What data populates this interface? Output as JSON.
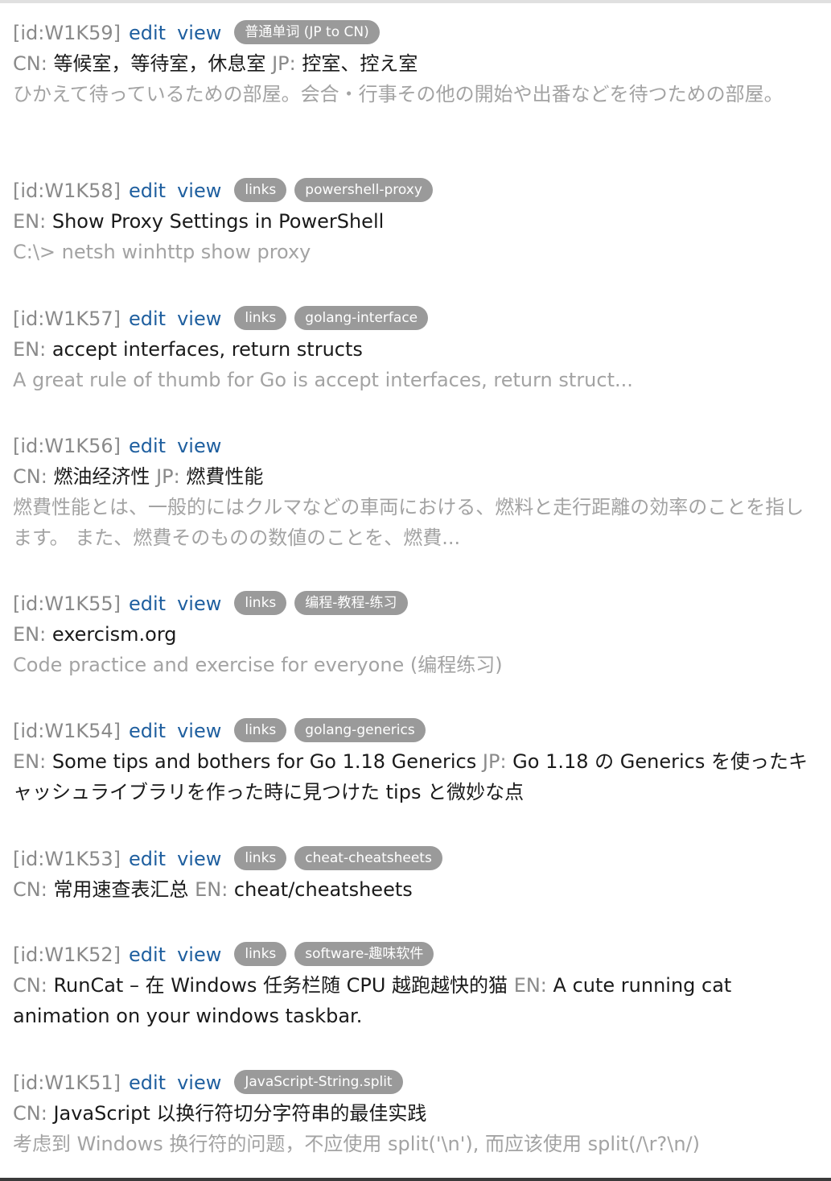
{
  "action_labels": {
    "edit": "edit",
    "view": "view"
  },
  "entries": [
    {
      "id": "[id:W1K59]",
      "tags": [
        "普通单词 (JP to CN)"
      ],
      "line": [
        {
          "label": "CN:",
          "text": "等候室，等待室，休息室"
        },
        {
          "label": "JP:",
          "text": "控室、控え室"
        }
      ],
      "desc": "ひかえて待っているための部屋。会合・行事その他の開始や出番などを待つための部屋。"
    },
    {
      "id": "[id:W1K58]",
      "tags": [
        "links",
        "powershell-proxy"
      ],
      "line": [
        {
          "label": "EN:",
          "text": "Show Proxy Settings in PowerShell"
        }
      ],
      "desc": "C:\\> netsh winhttp show proxy"
    },
    {
      "id": "[id:W1K57]",
      "tags": [
        "links",
        "golang-interface"
      ],
      "line": [
        {
          "label": "EN:",
          "text": "accept interfaces, return structs"
        }
      ],
      "desc": "A great rule of thumb for Go is accept interfaces, return struct..."
    },
    {
      "id": "[id:W1K56]",
      "tags": [],
      "line": [
        {
          "label": "CN:",
          "text": "燃油经济性"
        },
        {
          "label": "JP:",
          "text": "燃費性能"
        }
      ],
      "desc": "燃費性能とは、一般的にはクルマなどの車両における、燃料と走行距離の効率のことを指します。 また、燃費そのものの数値のことを、燃費..."
    },
    {
      "id": "[id:W1K55]",
      "tags": [
        "links",
        "编程-教程-练习"
      ],
      "line": [
        {
          "label": "EN:",
          "text": "exercism.org"
        }
      ],
      "desc": "Code practice and exercise for everyone (编程练习)"
    },
    {
      "id": "[id:W1K54]",
      "tags": [
        "links",
        "golang-generics"
      ],
      "line": [
        {
          "label": "EN:",
          "text": "Some tips and bothers for Go 1.18 Generics"
        },
        {
          "label": "JP:",
          "text": "Go 1.18 の Generics を使ったキャッシュライブラリを作った時に見つけた tips と微妙な点"
        }
      ],
      "desc": ""
    },
    {
      "id": "[id:W1K53]",
      "tags": [
        "links",
        "cheat-cheatsheets"
      ],
      "line": [
        {
          "label": "CN:",
          "text": "常用速查表汇总"
        },
        {
          "label": "EN:",
          "text": "cheat/cheatsheets"
        }
      ],
      "desc": ""
    },
    {
      "id": "[id:W1K52]",
      "tags": [
        "links",
        "software-趣味软件"
      ],
      "line": [
        {
          "label": "CN:",
          "text": "RunCat – 在 Windows 任务栏随 CPU 越跑越快的猫"
        },
        {
          "label": "EN:",
          "text": "A cute running cat animation on your windows taskbar."
        }
      ],
      "desc": ""
    },
    {
      "id": "[id:W1K51]",
      "tags": [
        "JavaScript-String.split"
      ],
      "line": [
        {
          "label": "CN:",
          "text": "JavaScript 以换行符切分字符串的最佳实践"
        }
      ],
      "desc": "考虑到 Windows 换行符的问题，不应使用 split('\\n'), 而应该使用 split(/\\r?\\n/)"
    }
  ]
}
